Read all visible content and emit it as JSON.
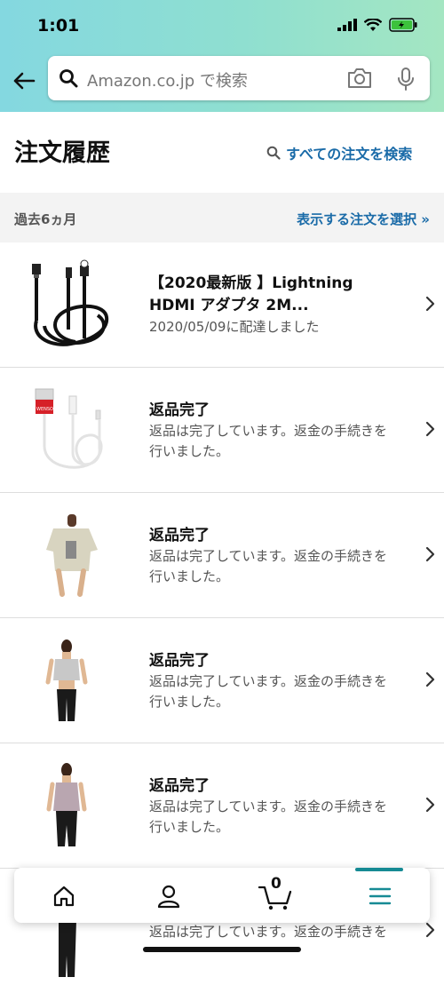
{
  "status_bar": {
    "time": "1:01"
  },
  "search": {
    "placeholder": "Amazon.co.jp で検索"
  },
  "page": {
    "title": "注文履歴",
    "search_all_label": "すべての注文を検索"
  },
  "filter": {
    "period": "過去6ヵ月",
    "select_label": "表示する注文を選択 »"
  },
  "orders": [
    {
      "title_line1": "【2020最新版 】Lightning",
      "title_line2": "HDMI アダプタ 2M...",
      "sub_line1": "2020/05/09に配達しました",
      "sub_line2": "",
      "thumb": "black-hdmi-cable"
    },
    {
      "title_line1": "返品完了",
      "title_line2": "",
      "sub_line1": "返品は完了しています。返金の手続きを",
      "sub_line2": "行いました。",
      "thumb": "white-hdmi-cable"
    },
    {
      "title_line1": "返品完了",
      "title_line2": "",
      "sub_line1": "返品は完了しています。返金の手続きを",
      "sub_line2": "行いました。",
      "thumb": "beige-tshirt"
    },
    {
      "title_line1": "返品完了",
      "title_line2": "",
      "sub_line1": "返品は完了しています。返金の手続きを",
      "sub_line2": "行いました。",
      "thumb": "crop-top"
    },
    {
      "title_line1": "返品完了",
      "title_line2": "",
      "sub_line1": "返品は完了しています。返金の手続きを",
      "sub_line2": "行いました。",
      "thumb": "camisole"
    },
    {
      "title_line1": "",
      "title_line2": "",
      "sub_line1": "返品は完了しています。返金の手続きを",
      "sub_line2": "",
      "thumb": "partial-figure"
    }
  ],
  "bottom_nav": {
    "items": [
      "home-icon",
      "account-icon",
      "cart-icon",
      "menu-icon"
    ],
    "cart_count": "0",
    "active": "menu"
  },
  "colors": {
    "accent": "#168a94",
    "link": "#1a6ba8",
    "header_start": "#84d8e0",
    "header_end": "#a4e6c2"
  }
}
